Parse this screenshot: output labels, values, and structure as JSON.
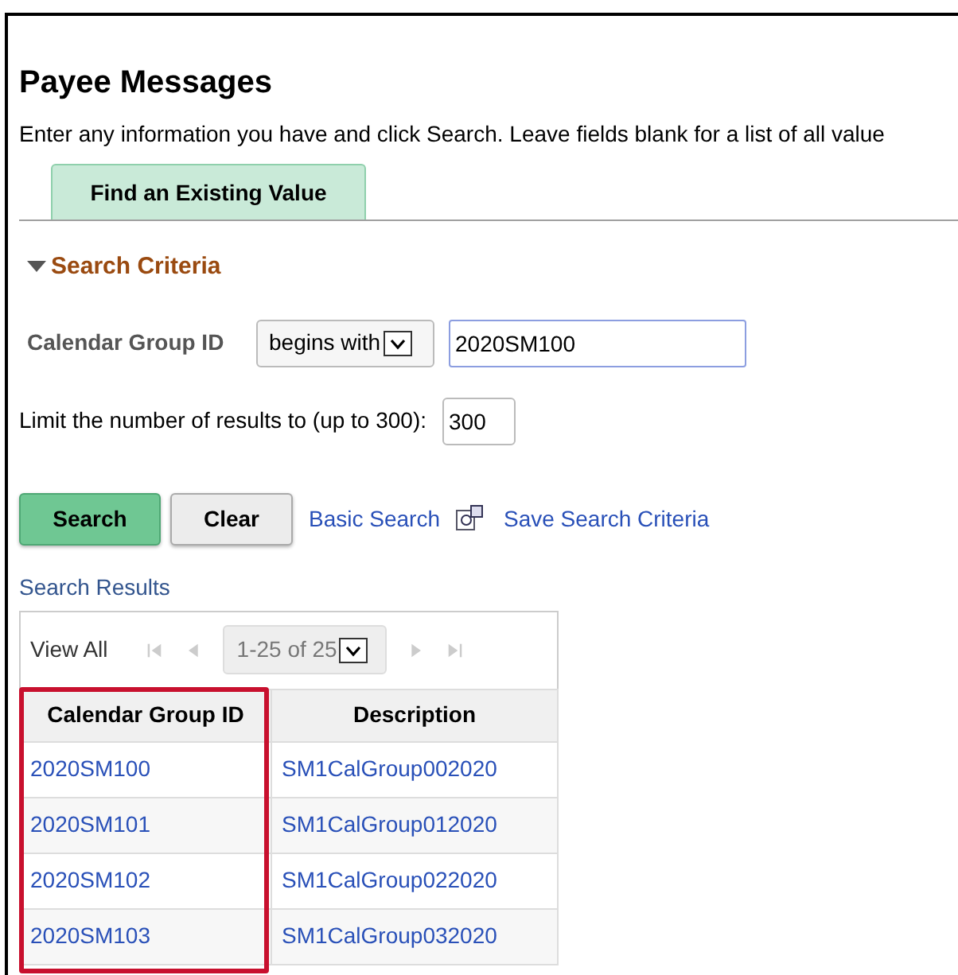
{
  "page": {
    "title": "Payee Messages",
    "instructions": "Enter any information you have and click Search. Leave fields blank for a list of all value"
  },
  "tabs": [
    {
      "label": "Find an Existing Value",
      "selected": true
    }
  ],
  "search_criteria": {
    "heading": "Search Criteria",
    "expanded": true,
    "field": {
      "label": "Calendar Group ID",
      "operator": "begins with",
      "value": "2020SM100"
    },
    "limit": {
      "label": "Limit the number of results to (up to 300):",
      "value": "300"
    }
  },
  "buttons": [
    {
      "label": "Search",
      "kind": "primary"
    },
    {
      "label": "Clear",
      "kind": "secondary"
    }
  ],
  "links": [
    {
      "label": "Basic Search",
      "icon": false
    },
    {
      "label": "Save Search Criteria",
      "icon": true
    }
  ],
  "results": {
    "title": "Search Results",
    "view_all": "View All",
    "range": "1-25 of 25",
    "columns": [
      {
        "label": "Calendar Group ID",
        "highlighted": true
      },
      {
        "label": "Description",
        "highlighted": false
      }
    ],
    "rows": [
      [
        "2020SM100",
        "SM1CalGroup002020"
      ],
      [
        "2020SM101",
        "SM1CalGroup012020"
      ],
      [
        "2020SM102",
        "SM1CalGroup022020"
      ],
      [
        "2020SM103",
        "SM1CalGroup032020"
      ]
    ]
  }
}
